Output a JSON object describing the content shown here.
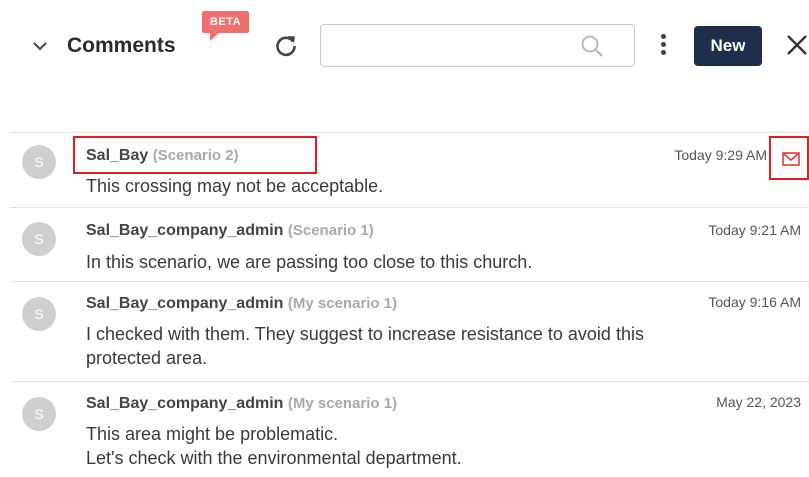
{
  "header": {
    "title": "Comments",
    "beta_badge": "BETA",
    "search": {
      "value": "",
      "placeholder": ""
    },
    "new_label": "New"
  },
  "colors": {
    "badge": "#f07070",
    "primary_button": "#1f2e4a",
    "highlight": "#e02020",
    "mail_icon": "#e53935"
  },
  "comments": [
    {
      "avatar": "S",
      "author": "Sal_Bay",
      "scenario": "(Scenario 2)",
      "time": "Today 9:29 AM",
      "lines": [
        "This crossing may not be acceptable."
      ],
      "unread_mail_icon": "mail-icon"
    },
    {
      "avatar": "S",
      "author": "Sal_Bay_company_admin",
      "scenario": "(Scenario 1)",
      "time": "Today 9:21 AM",
      "lines": [
        "In this scenario, we are passing too close to this church."
      ]
    },
    {
      "avatar": "S",
      "author": "Sal_Bay_company_admin",
      "scenario": "(My scenario 1)",
      "time": "Today 9:16 AM",
      "lines": [
        "I checked with them. They suggest to increase resistance to avoid this",
        "protected area."
      ]
    },
    {
      "avatar": "S",
      "author": "Sal_Bay_company_admin",
      "scenario": "(My scenario 1)",
      "time": "May 22, 2023",
      "lines": [
        "This area might be problematic.",
        "Let's check with the environmental department."
      ]
    }
  ]
}
